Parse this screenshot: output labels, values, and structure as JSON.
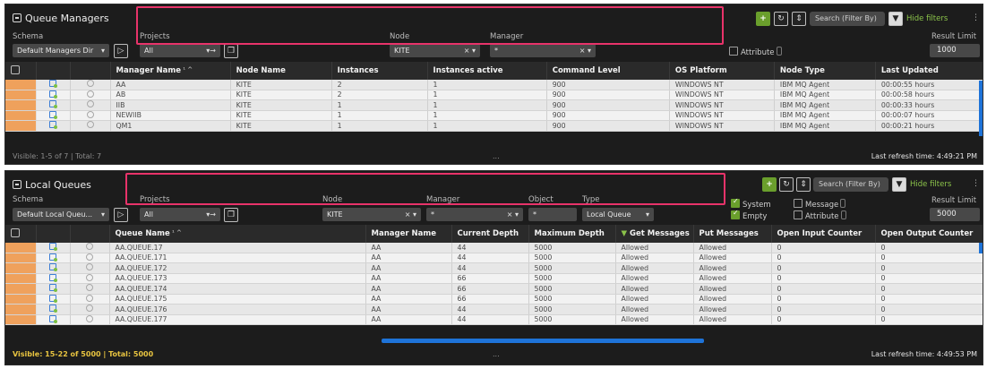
{
  "colors": {
    "highlight": "#e8336a",
    "accent_green": "#6a9f2c",
    "row_indicator": "#efa15c",
    "scroll_blue": "#1e73d8"
  },
  "qm": {
    "title": "Queue Managers",
    "schema_label": "Schema",
    "schema_value": "Default Managers Dir",
    "projects_label": "Projects",
    "projects_value": "All",
    "node_label": "Node",
    "node_value": "KITE",
    "manager_label": "Manager",
    "manager_value": "*",
    "attribute_label": "Attribute",
    "search_placeholder": "Search (Filter By)",
    "hide_filters": "Hide filters",
    "result_limit_label": "Result Limit",
    "result_limit_value": "1000",
    "columns": [
      "Manager Name",
      "Node Name",
      "Instances",
      "Instances active",
      "Command Level",
      "OS Platform",
      "Node Type",
      "Last Updated"
    ],
    "rows": [
      [
        "AA",
        "KITE",
        "2",
        "1",
        "900",
        "WINDOWS NT",
        "IBM MQ Agent",
        "00:00:55 hours"
      ],
      [
        "AB",
        "KITE",
        "2",
        "1",
        "900",
        "WINDOWS NT",
        "IBM MQ Agent",
        "00:00:58 hours"
      ],
      [
        "IIB",
        "KITE",
        "1",
        "1",
        "900",
        "WINDOWS NT",
        "IBM MQ Agent",
        "00:00:33 hours"
      ],
      [
        "NEWIIB",
        "KITE",
        "1",
        "1",
        "900",
        "WINDOWS NT",
        "IBM MQ Agent",
        "00:00:07 hours"
      ],
      [
        "QM1",
        "KITE",
        "1",
        "1",
        "900",
        "WINDOWS NT",
        "IBM MQ Agent",
        "00:00:21 hours"
      ]
    ],
    "footer_left": "Visible: 1-5 of 7 | Total: 7",
    "footer_mid": "...",
    "footer_right": "Last refresh time: 4:49:21 PM"
  },
  "lq": {
    "title": "Local Queues",
    "schema_label": "Schema",
    "schema_value": "Default Local Queu...",
    "projects_label": "Projects",
    "projects_value": "All",
    "node_label": "Node",
    "node_value": "KITE",
    "manager_label": "Manager",
    "manager_value": "*",
    "object_label": "Object",
    "object_value": "*",
    "type_label": "Type",
    "type_value": "Local Queue",
    "system_label": "System",
    "empty_label": "Empty",
    "message_label": "Message",
    "attribute_label": "Attribute",
    "search_placeholder": "Search (Filter By)",
    "hide_filters": "Hide filters",
    "result_limit_label": "Result Limit",
    "result_limit_value": "5000",
    "columns": [
      "Queue Name",
      "Manager Name",
      "Current Depth",
      "Maximum Depth",
      "Get Messages",
      "Put Messages",
      "Open Input Counter",
      "Open Output Counter"
    ],
    "rows": [
      [
        "AA.QUEUE.17",
        "AA",
        "44",
        "5000",
        "Allowed",
        "Allowed",
        "0",
        "0"
      ],
      [
        "AA.QUEUE.171",
        "AA",
        "44",
        "5000",
        "Allowed",
        "Allowed",
        "0",
        "0"
      ],
      [
        "AA.QUEUE.172",
        "AA",
        "44",
        "5000",
        "Allowed",
        "Allowed",
        "0",
        "0"
      ],
      [
        "AA.QUEUE.173",
        "AA",
        "66",
        "5000",
        "Allowed",
        "Allowed",
        "0",
        "0"
      ],
      [
        "AA.QUEUE.174",
        "AA",
        "66",
        "5000",
        "Allowed",
        "Allowed",
        "0",
        "0"
      ],
      [
        "AA.QUEUE.175",
        "AA",
        "66",
        "5000",
        "Allowed",
        "Allowed",
        "0",
        "0"
      ],
      [
        "AA.QUEUE.176",
        "AA",
        "44",
        "5000",
        "Allowed",
        "Allowed",
        "0",
        "0"
      ],
      [
        "AA.QUEUE.177",
        "AA",
        "44",
        "5000",
        "Allowed",
        "Allowed",
        "0",
        "0"
      ]
    ],
    "footer_left": "Visible: 15-22 of 5000 | Total: 5000",
    "footer_mid": "...",
    "footer_right": "Last refresh time: 4:49:53 PM"
  }
}
